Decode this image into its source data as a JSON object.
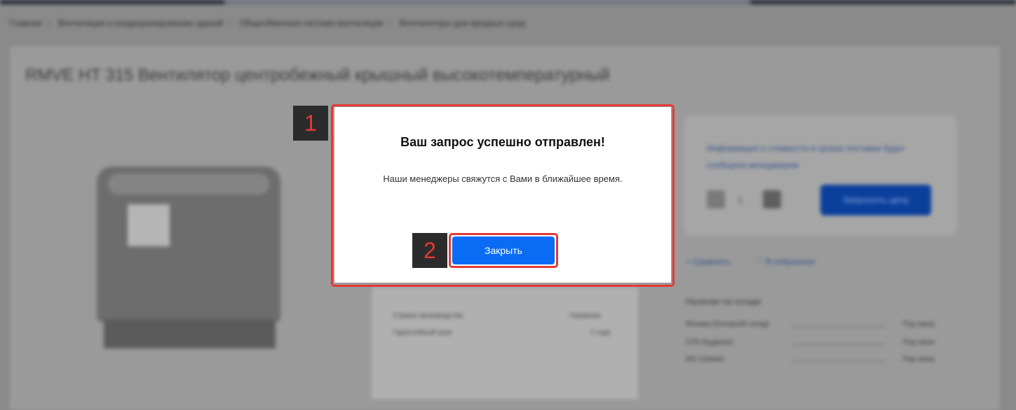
{
  "breadcrumb": {
    "items": [
      "Главная",
      "Вентиляция и кондиционирование зданий",
      "Общеобменная система вентиляции",
      "Вентиляторы для вредных сред"
    ]
  },
  "product": {
    "title": "RMVE HT 315 Вентилятор центробежный крышный высокотемпературный"
  },
  "buy_panel": {
    "stock_info": "Информация о стоимости и сроках поставки будет сообщена менеджером",
    "quantity": "1",
    "add_to_cart_label": "Запросить цену",
    "compare_label": "Сравнить",
    "favorite_label": "В избранное"
  },
  "specs": [
    {
      "label": "Страна производства",
      "value": "Германия"
    },
    {
      "label": "Гарантийный срок",
      "value": "2 года"
    }
  ],
  "availability": {
    "title": "Наличие на складе",
    "stores": [
      {
        "name": "Москва (Основной склад)",
        "status": "Под заказ"
      },
      {
        "name": "СПб (Кудрово)",
        "status": "Под заказ"
      },
      {
        "name": "МО (Химки)",
        "status": "Под заказ"
      }
    ]
  },
  "modal": {
    "title": "Ваш запрос успешно отправлен!",
    "message": "Наши менеджеры свяжутся с Вами в ближайшее время.",
    "close_label": "Закрыть"
  },
  "annotations": {
    "badge_1": "1",
    "badge_2": "2",
    "highlight_color": "#e53935"
  },
  "colors": {
    "primary_button": "#0a6cf5",
    "overlay": "#8a8a8a"
  }
}
